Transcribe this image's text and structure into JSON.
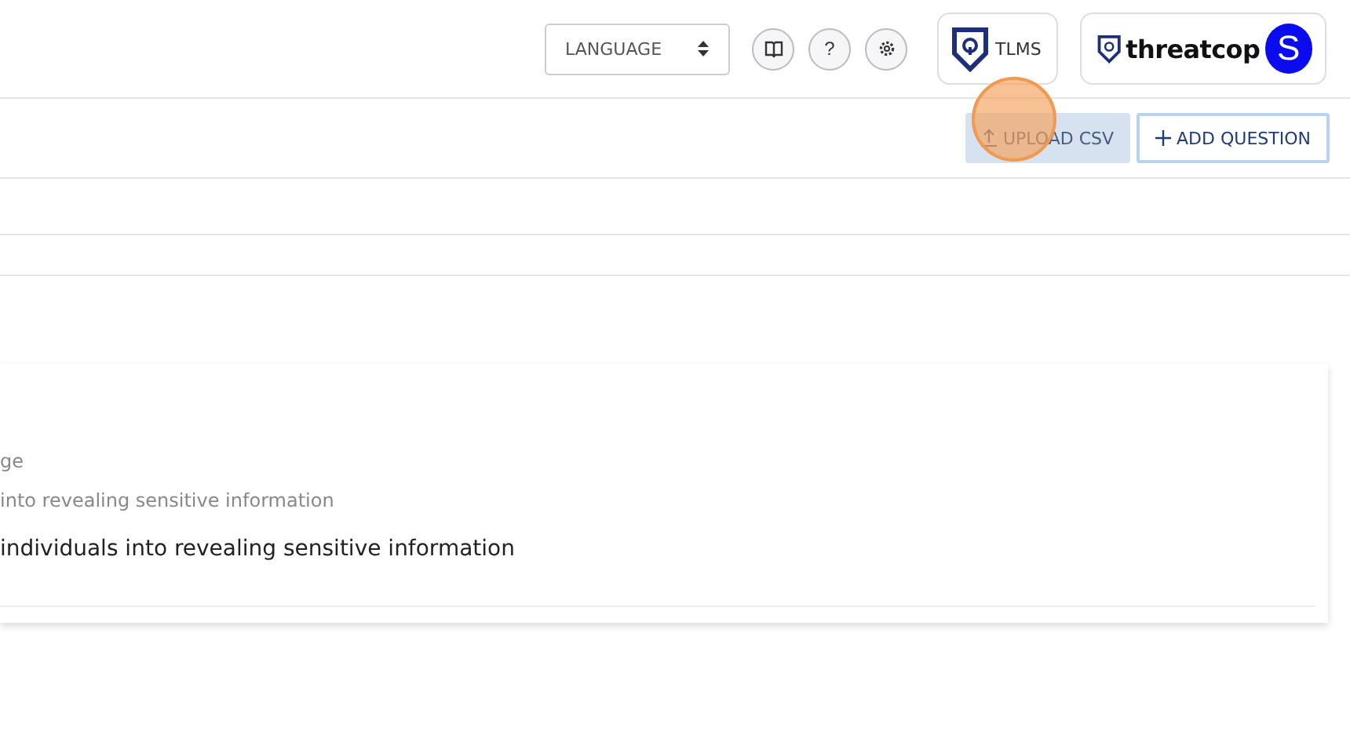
{
  "header": {
    "language_select": {
      "placeholder": "LANGUAGE"
    },
    "help_text": "?",
    "tlms_label": "TLMS",
    "logo_text": "threatcop",
    "avatar_initial": "S"
  },
  "toolbar": {
    "buttons": [
      {
        "label": "UPLOAD CSV",
        "kind": "upload"
      },
      {
        "label": "ADD QUESTION",
        "kind": "add"
      }
    ],
    "click_indicator": true
  },
  "question_card": {
    "lines": [
      {
        "text": "ge",
        "kind": "sub"
      },
      {
        "text": "into revealing sensitive information",
        "kind": "sub"
      },
      {
        "text": "individuals into revealing sensitive information",
        "kind": "main"
      }
    ]
  }
}
